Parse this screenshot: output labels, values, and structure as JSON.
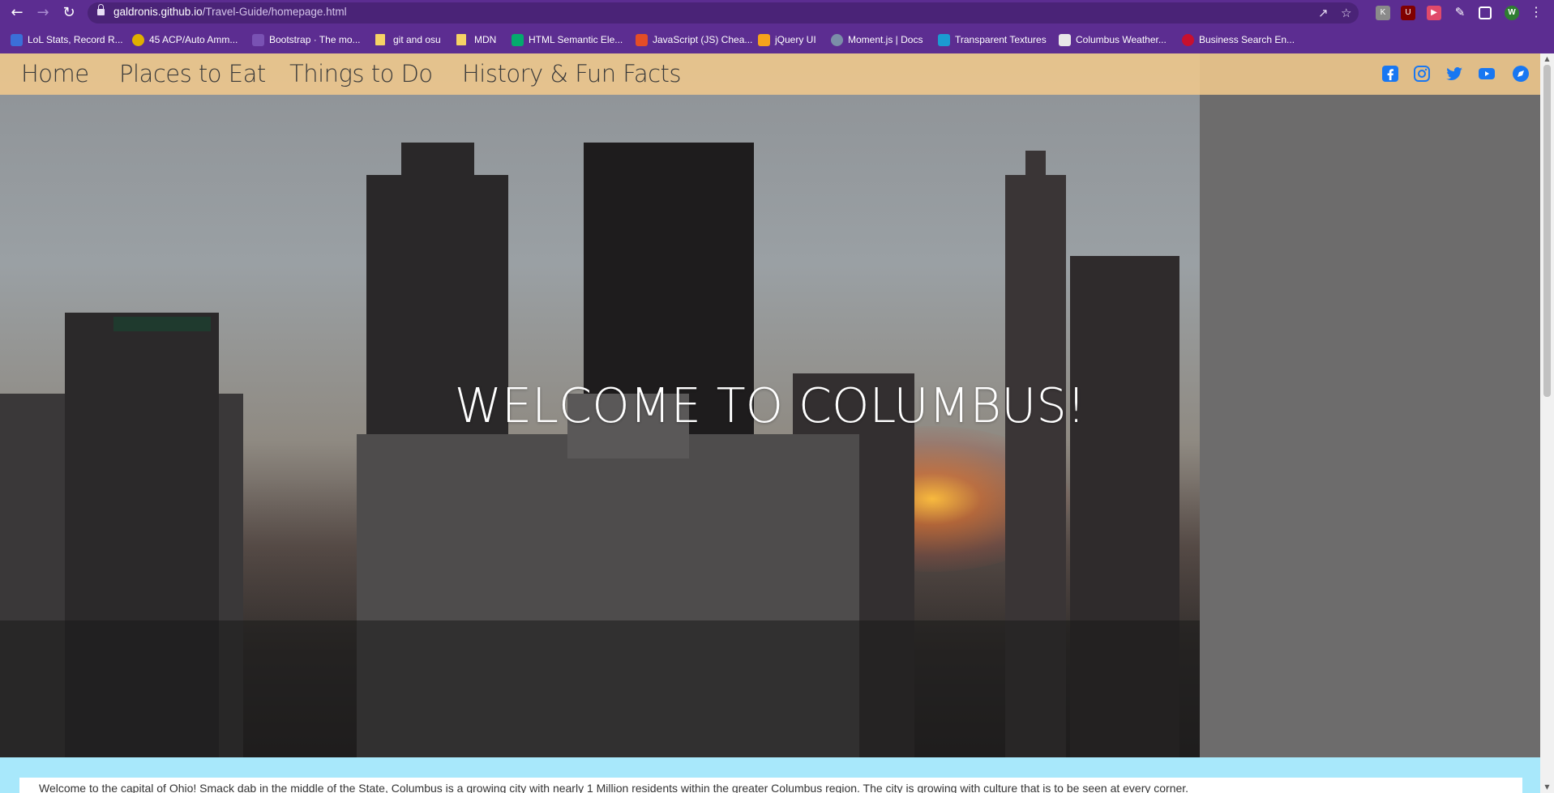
{
  "browser": {
    "url_domain": "galdronis.github.io",
    "url_path": "/Travel-Guide/homepage.html",
    "profile_initial": "W",
    "bookmarks": [
      {
        "label": "LoL Stats, Record R...",
        "icon_color": "#3b6fd8"
      },
      {
        "label": "45 ACP/Auto Amm...",
        "icon_color": "#e0b000"
      },
      {
        "label": "Bootstrap · The mo...",
        "icon_color": "#7952b3"
      },
      {
        "label": "git and osu",
        "icon_color": "#f6d365"
      },
      {
        "label": "MDN",
        "icon_color": "#f6d365"
      },
      {
        "label": "HTML Semantic Ele...",
        "icon_color": "#04aa6d"
      },
      {
        "label": "JavaScript (JS) Chea...",
        "icon_color": "#e44d26"
      },
      {
        "label": "jQuery UI",
        "icon_color": "#f7a21b"
      },
      {
        "label": "Moment.js | Docs",
        "icon_color": "#7b8ea8"
      },
      {
        "label": "Transparent Textures",
        "icon_color": "#1b9bd1"
      },
      {
        "label": "Columbus Weather...",
        "icon_color": "#e8e8e8"
      },
      {
        "label": "Business Search En...",
        "icon_color": "#c8102e"
      }
    ]
  },
  "site": {
    "nav": [
      "Home",
      "Places to Eat",
      "Things to Do",
      "History & Fun Facts"
    ],
    "social_icons": [
      "facebook-icon",
      "instagram-icon",
      "twitter-icon",
      "youtube-icon",
      "blog-icon"
    ],
    "social_color": "#1877f2",
    "hero_title": "WELCOME TO COLUMBUS!",
    "intro_text": "Welcome to the capital of Ohio! Smack dab in the middle of the State, Columbus is a growing city with nearly 1 Million residents within the greater Columbus region. The city is growing with culture that is to be seen at every corner.",
    "nav_bg": "#f0c88c",
    "lower_bg": "#a8e8fb"
  }
}
